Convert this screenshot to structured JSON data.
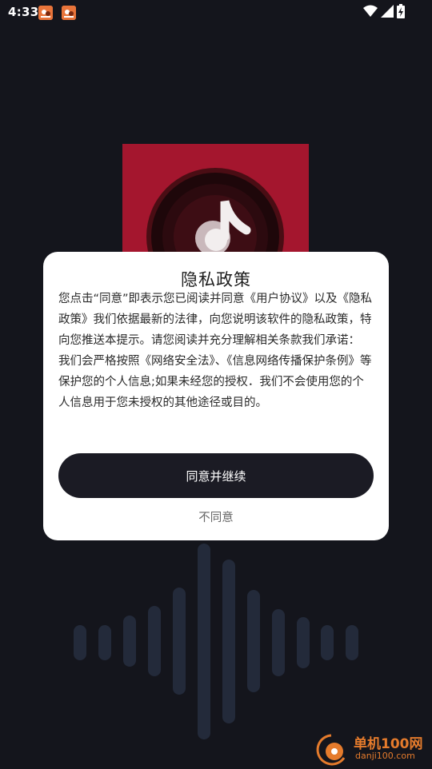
{
  "status_bar": {
    "time": "4:33",
    "left_icons": [
      "notification-app-icon",
      "notification-app-icon"
    ],
    "right_icons": [
      "wifi-icon",
      "signal-icon",
      "battery-charging-icon"
    ]
  },
  "dialog": {
    "title": "隐私政策",
    "paragraph_1": "您点击“同意”即表示您已阅读并同意《用户协议》以及《隐私政策》我们依据最新的法律，向您说明该软件的隐私政策，特向您推送本提示。请您阅读并充分理解相关条款我们承诺：",
    "paragraph_2": "我们会严格按照《网络安全法》、《信息网络传播保护条例》等保护您的个人信息;如果未经您的授权．我们不会使用您的个人信息用于您未授权的其他途径或目的。",
    "agree_label": "同意并继续",
    "disagree_label": "不同意"
  },
  "watermark": {
    "name": "单机100网",
    "domain": "danji100.com"
  },
  "colors": {
    "background": "#14151c",
    "app_icon_red": "#a4162e",
    "button_dark": "#1b1b24",
    "watermark_orange": "#e57b2c"
  }
}
